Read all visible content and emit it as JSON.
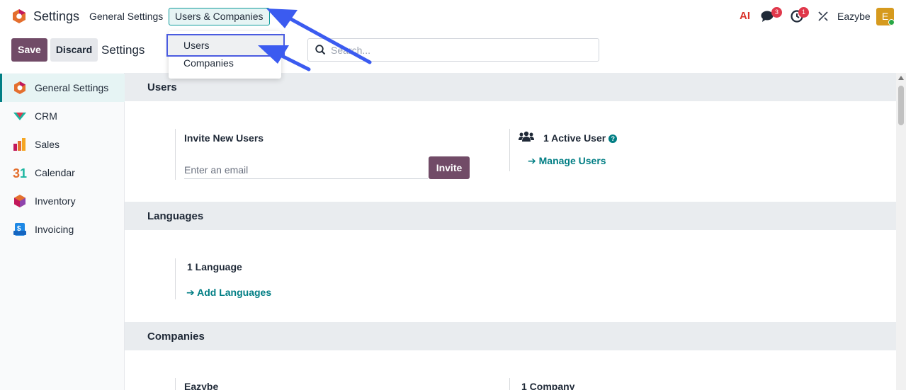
{
  "app": {
    "name": "Settings",
    "user_name": "Eazybe",
    "avatar_letter": "E"
  },
  "top_menu": {
    "general_settings": "General Settings",
    "users_companies": "Users & Companies"
  },
  "system_tray": {
    "ai_icon": "AI",
    "messages_badge": "3",
    "activities_badge": "1"
  },
  "control_panel": {
    "save_label": "Save",
    "discard_label": "Discard",
    "title": "Settings",
    "search_placeholder": "Search..."
  },
  "dropdown": {
    "items": [
      "Users",
      "Companies"
    ]
  },
  "sidebar": {
    "items": [
      {
        "label": "General Settings",
        "icon": "settings-app-icon",
        "active": true
      },
      {
        "label": "CRM",
        "icon": "crm-app-icon"
      },
      {
        "label": "Sales",
        "icon": "sales-app-icon"
      },
      {
        "label": "Calendar",
        "icon": "calendar-app-icon"
      },
      {
        "label": "Inventory",
        "icon": "inventory-app-icon"
      },
      {
        "label": "Invoicing",
        "icon": "invoicing-app-icon"
      }
    ]
  },
  "sections": {
    "users": {
      "title": "Users",
      "invite_label": "Invite New Users",
      "email_placeholder": "Enter an email",
      "invite_button": "Invite",
      "active_users": "1 Active User",
      "manage_users": "Manage Users"
    },
    "languages": {
      "title": "Languages",
      "count": "1 Language",
      "add_languages": "Add Languages"
    },
    "companies": {
      "title": "Companies",
      "company_name": "Eazybe",
      "count": "1 Company"
    }
  },
  "colors": {
    "primary": "#714b67",
    "link": "#017e84",
    "annotation_arrow": "#3b5bf0",
    "badge": "#e0384b"
  }
}
